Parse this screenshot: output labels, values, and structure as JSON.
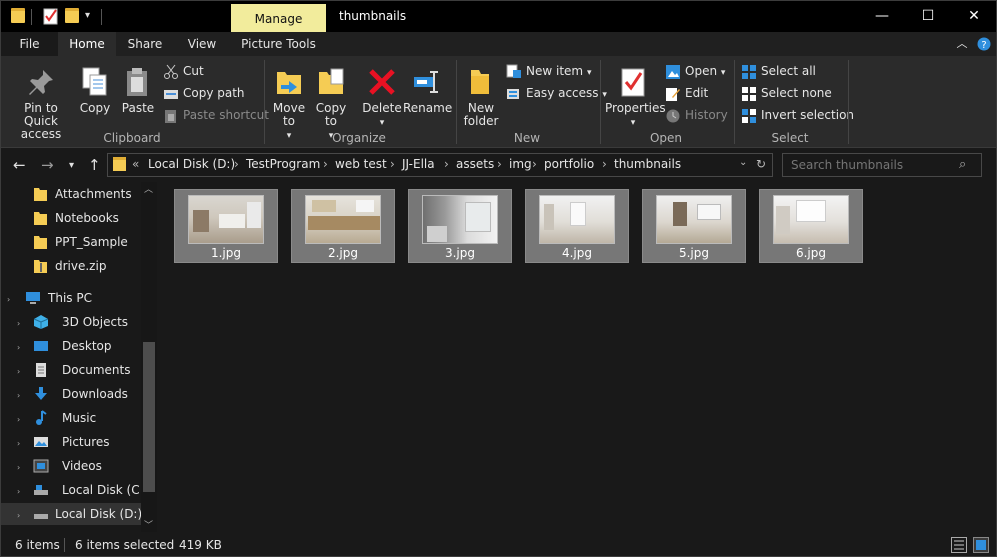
{
  "window": {
    "title": "thumbnails",
    "context_tab": "Manage",
    "controls": {
      "minimize": "—",
      "maximize": "☐",
      "close": "✕"
    }
  },
  "quick_access": [
    "folder-icon",
    "properties-check-icon",
    "new-folder-icon",
    "customize-dropdown-icon"
  ],
  "ribbon_tabs": [
    "File",
    "Home",
    "Share",
    "View",
    "Picture Tools"
  ],
  "active_tab": "Home",
  "ribbon": {
    "clipboard": {
      "label": "Clipboard",
      "pin": "Pin to Quick access",
      "copy": "Copy",
      "paste": "Paste",
      "cut": "Cut",
      "copy_path": "Copy path",
      "paste_shortcut": "Paste shortcut"
    },
    "organize": {
      "label": "Organize",
      "move_to": "Move to",
      "copy_to": "Copy to",
      "delete": "Delete",
      "rename": "Rename"
    },
    "new": {
      "label": "New",
      "new_folder": "New folder",
      "new_item": "New item",
      "easy_access": "Easy access"
    },
    "open": {
      "label": "Open",
      "properties": "Properties",
      "open": "Open",
      "edit": "Edit",
      "history": "History"
    },
    "select": {
      "label": "Select",
      "select_all": "Select all",
      "select_none": "Select none",
      "invert": "Invert selection"
    }
  },
  "address": {
    "overflow": "«",
    "crumbs": [
      "Local Disk (D:)",
      "TestProgram",
      "web test",
      "JJ-Ella",
      "assets",
      "img",
      "portfolio",
      "thumbnails"
    ],
    "search_placeholder": "Search thumbnails"
  },
  "nav_pane": {
    "items": [
      {
        "label": "Attachments",
        "icon": "folder-icon"
      },
      {
        "label": "Notebooks",
        "icon": "folder-icon"
      },
      {
        "label": "PPT_Sample",
        "icon": "folder-icon"
      },
      {
        "label": "drive.zip",
        "icon": "zip-folder-icon"
      },
      {
        "label": "This PC",
        "icon": "computer-icon"
      },
      {
        "label": "3D Objects",
        "icon": "3d-objects-icon"
      },
      {
        "label": "Desktop",
        "icon": "desktop-icon"
      },
      {
        "label": "Documents",
        "icon": "documents-icon"
      },
      {
        "label": "Downloads",
        "icon": "downloads-icon"
      },
      {
        "label": "Music",
        "icon": "music-icon"
      },
      {
        "label": "Pictures",
        "icon": "pictures-icon"
      },
      {
        "label": "Videos",
        "icon": "videos-icon"
      },
      {
        "label": "Local Disk (C:)",
        "icon": "drive-icon"
      },
      {
        "label": "Local Disk (D:)",
        "icon": "drive-icon"
      }
    ]
  },
  "files": [
    {
      "name": "1.jpg"
    },
    {
      "name": "2.jpg"
    },
    {
      "name": "3.jpg"
    },
    {
      "name": "4.jpg"
    },
    {
      "name": "5.jpg"
    },
    {
      "name": "6.jpg"
    }
  ],
  "status": {
    "count": "6 items",
    "selected": "6 items selected",
    "size": "419 KB"
  },
  "colors": {
    "folder": "#f5cc54",
    "manage_tab": "#f2ec9c",
    "selection": "#777777",
    "delete_red": "#e81123",
    "accent_blue": "#2f8fdd"
  }
}
